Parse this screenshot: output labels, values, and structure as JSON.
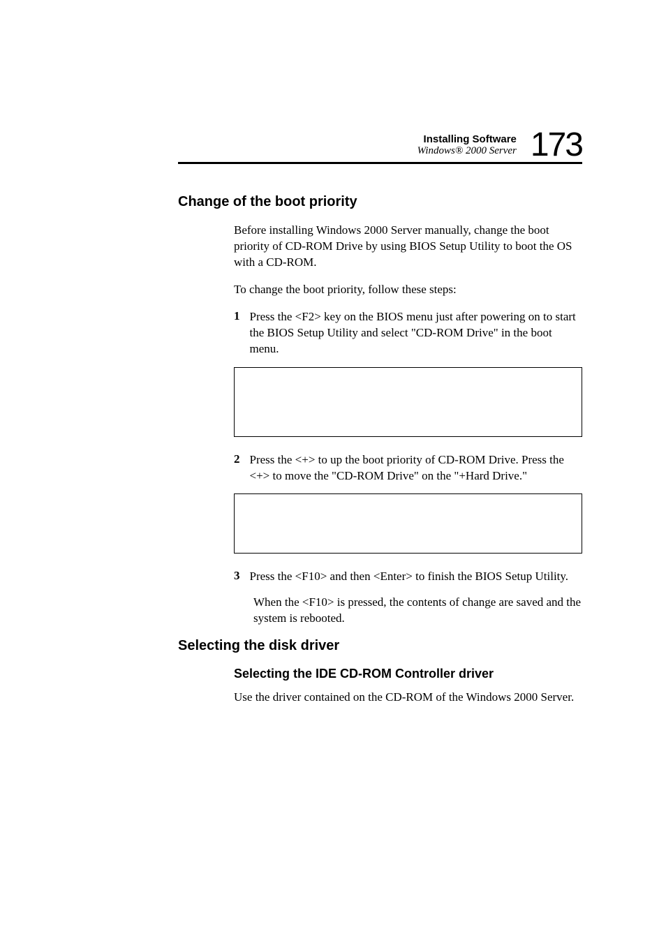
{
  "header": {
    "title": "Installing Software",
    "subtitle": "Windows® 2000 Server",
    "page_number": "173"
  },
  "section1": {
    "heading": "Change of the boot priority",
    "intro": "Before installing Windows 2000 Server manually, change the boot priority of CD-ROM Drive by using BIOS Setup Utility to boot the OS with a CD-ROM.",
    "instruction": "To change the boot priority, follow these steps:",
    "step1_num": "1",
    "step1_text": "Press the <F2> key on the BIOS menu just after powering on to start the BIOS Setup Utility and select \"CD-ROM Drive\" in the boot menu.",
    "step2_num": "2",
    "step2_text": "Press the <+> to up the boot priority of CD-ROM Drive. Press the <+> to move the \"CD-ROM Drive\" on the \"+Hard Drive.\"",
    "step3_num": "3",
    "step3_text": "Press the <F10> and then <Enter> to finish the BIOS Setup Utility.",
    "step3_note": "When the <F10> is pressed, the contents of change are saved and the system is rebooted."
  },
  "section2": {
    "heading": "Selecting the disk driver",
    "subheading": "Selecting the IDE CD-ROM Controller driver",
    "text": "Use the driver contained on the CD-ROM of the Windows 2000 Server."
  }
}
